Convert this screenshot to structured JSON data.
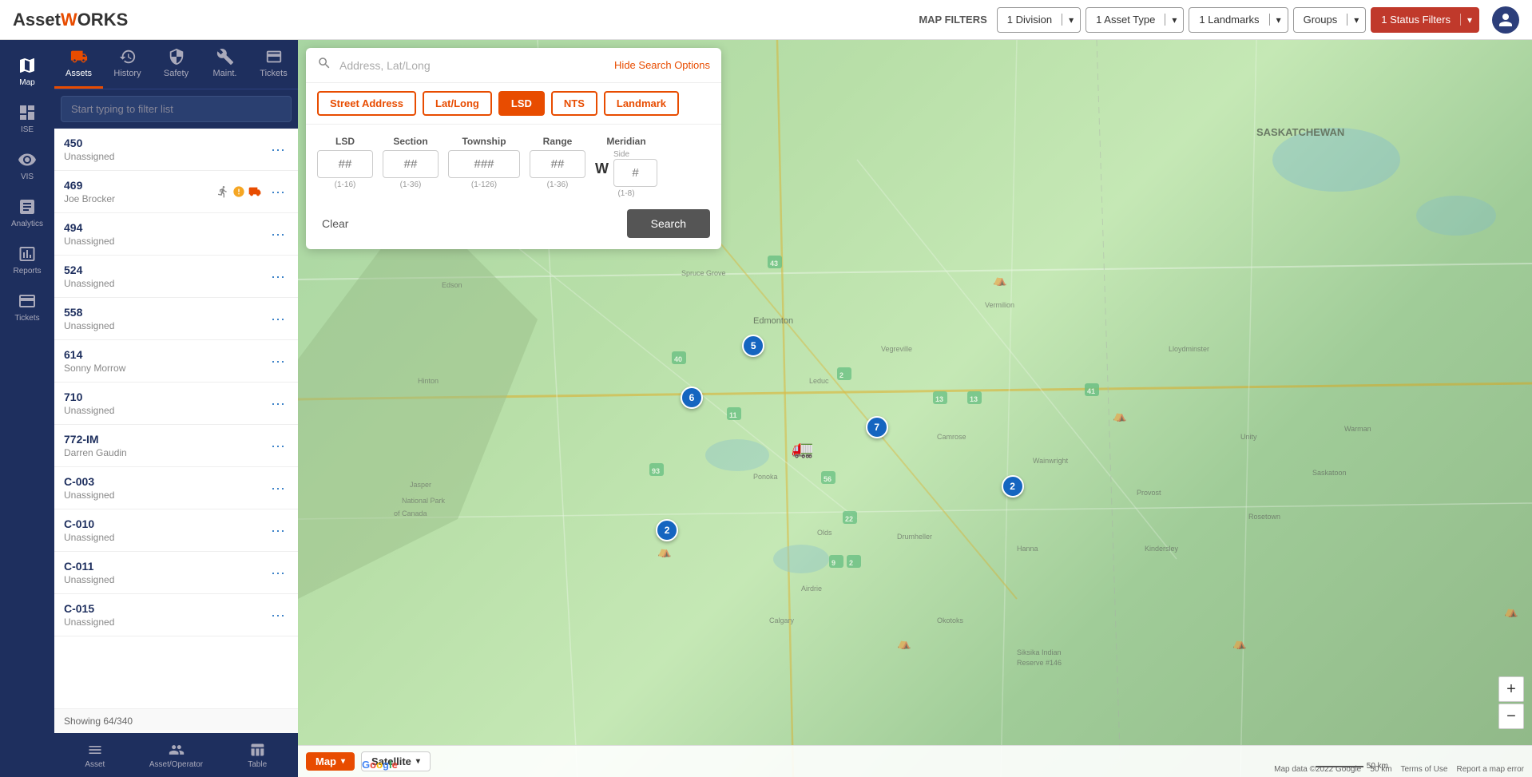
{
  "app": {
    "name": "Asset",
    "name_highlight": "W",
    "logo_text": "AssetWORKS"
  },
  "header": {
    "map_filters_label": "MAP FILTERS",
    "filters": [
      {
        "label": "1 Division",
        "id": "division-filter"
      },
      {
        "label": "1 Asset Type",
        "id": "asset-type-filter"
      },
      {
        "label": "1 Landmarks",
        "id": "landmarks-filter"
      },
      {
        "label": "Groups",
        "id": "groups-filter"
      }
    ],
    "status_filter": "1 Status Filters"
  },
  "left_sidebar": {
    "items": [
      {
        "label": "Map",
        "active": true,
        "id": "map"
      },
      {
        "label": "ISE",
        "active": false,
        "id": "ise"
      },
      {
        "label": "VIS",
        "active": false,
        "id": "vis"
      },
      {
        "label": "Analytics",
        "active": false,
        "id": "analytics"
      },
      {
        "label": "Reports",
        "active": false,
        "id": "reports"
      },
      {
        "label": "Tickets",
        "active": false,
        "id": "tickets"
      }
    ]
  },
  "assets_panel": {
    "tabs": [
      {
        "label": "Assets",
        "active": true,
        "id": "assets-tab"
      },
      {
        "label": "History",
        "active": false,
        "id": "history-tab"
      },
      {
        "label": "Safety",
        "active": false,
        "id": "safety-tab"
      },
      {
        "label": "Maint.",
        "active": false,
        "id": "maint-tab"
      },
      {
        "label": "Tickets",
        "active": false,
        "id": "tickets-tab"
      }
    ],
    "filter_placeholder": "Start typing to filter list",
    "assets": [
      {
        "id": "450",
        "name": "Unassigned",
        "has_icons": false
      },
      {
        "id": "469",
        "name": "Joe Brocker",
        "has_icons": true
      },
      {
        "id": "494",
        "name": "Unassigned",
        "has_icons": false
      },
      {
        "id": "524",
        "name": "Unassigned",
        "has_icons": false
      },
      {
        "id": "558",
        "name": "Unassigned",
        "has_icons": false
      },
      {
        "id": "614",
        "name": "Sonny Morrow",
        "has_icons": false
      },
      {
        "id": "710",
        "name": "Unassigned",
        "has_icons": false
      },
      {
        "id": "772-IM",
        "name": "Darren Gaudin",
        "has_icons": false
      },
      {
        "id": "C-003",
        "name": "Unassigned",
        "has_icons": false
      },
      {
        "id": "C-010",
        "name": "Unassigned",
        "has_icons": false
      },
      {
        "id": "C-011",
        "name": "Unassigned",
        "has_icons": false
      },
      {
        "id": "C-015",
        "name": "Unassigned",
        "has_icons": false
      }
    ],
    "showing_text": "Showing 64/340",
    "bottom_tabs": [
      {
        "label": "Asset",
        "id": "bottom-asset"
      },
      {
        "label": "Asset/Operator",
        "id": "bottom-asset-operator"
      },
      {
        "label": "Table",
        "id": "bottom-table"
      }
    ]
  },
  "search_overlay": {
    "placeholder": "Address, Lat/Long",
    "hide_label": "Hide Search Options",
    "types": [
      {
        "label": "Street Address",
        "id": "street-address",
        "active": false
      },
      {
        "label": "Lat/Long",
        "id": "lat-long",
        "active": false
      },
      {
        "label": "LSD",
        "id": "lsd",
        "active": true
      },
      {
        "label": "NTS",
        "id": "nts",
        "active": false
      },
      {
        "label": "Landmark",
        "id": "landmark",
        "active": false
      }
    ],
    "lsd_fields": {
      "lsd": {
        "label": "LSD",
        "placeholder": "##",
        "hint": "(1-16)"
      },
      "section": {
        "label": "Section",
        "placeholder": "##",
        "hint": "(1-36)"
      },
      "township": {
        "label": "Township",
        "placeholder": "###",
        "hint": "(1-126)"
      },
      "range": {
        "label": "Range",
        "placeholder": "##",
        "hint": "(1-36)"
      },
      "meridian": {
        "label": "Meridian",
        "side": "W",
        "side_label": "Side",
        "placeholder": "#",
        "hint": "(1-8)"
      }
    },
    "clear_label": "Clear",
    "search_label": "Search"
  },
  "map": {
    "markers": [
      {
        "x": 37,
        "y": 42,
        "label": "5",
        "type": "circle"
      },
      {
        "x": 30,
        "y": 50,
        "label": "6",
        "type": "circle"
      },
      {
        "x": 45,
        "y": 55,
        "label": "7",
        "type": "circle"
      },
      {
        "x": 55,
        "y": 62,
        "label": "2",
        "type": "circle"
      },
      {
        "x": 28,
        "y": 68,
        "label": "2",
        "type": "circle"
      },
      {
        "x": 31,
        "y": 60,
        "label": "🚛",
        "type": "truck"
      }
    ],
    "view_buttons": [
      {
        "label": "Map",
        "active": true
      },
      {
        "label": "Satellite",
        "active": false
      }
    ],
    "google_label": "Google",
    "attribution": "Map data ©2022 Google   50 km   Terms of Use   Report a map error",
    "scale": "50 km"
  }
}
